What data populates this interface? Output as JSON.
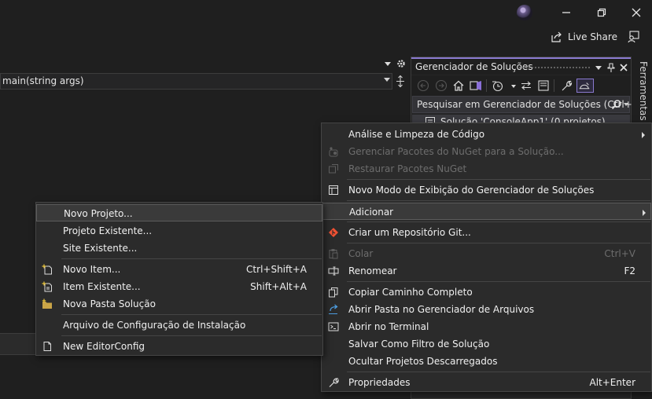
{
  "titlebar": {
    "live_share": "Live Share",
    "icons": [
      "avatar",
      "minimize-icon",
      "restore-icon",
      "close-icon",
      "live-share-icon",
      "feedback-icon"
    ]
  },
  "editor": {
    "nav_member": "main(string args)"
  },
  "solution_explorer": {
    "title": "Gerenciador de Soluções",
    "search_placeholder": "Pesquisar em Gerenciador de Soluções (Ctrl+",
    "tree_root": "Solução 'ConsoleApp1' (0 projetos)",
    "toolbar_icons": [
      "back-icon",
      "forward-icon",
      "home-icon",
      "vs-switch-icon",
      "history-icon",
      "sync-icon",
      "collapse-all-icon",
      "show-files-icon",
      "properties-icon",
      "preview-icon"
    ],
    "accent_color": "#8a7ad0"
  },
  "side_tab": {
    "label": "Ferramentas de"
  },
  "context_menu": {
    "items": [
      {
        "label": "Análise e Limpeza de Código",
        "shortcut": "",
        "submenu": true,
        "disabled": false,
        "icon": ""
      },
      {
        "label": "Gerenciar Pacotes do NuGet para a Solução...",
        "shortcut": "",
        "submenu": false,
        "disabled": true,
        "icon": "nuget-icon"
      },
      {
        "label": "Restaurar Pacotes NuGet",
        "shortcut": "",
        "submenu": false,
        "disabled": true,
        "icon": "restore-packages-icon"
      },
      {
        "label": "Novo Modo de Exibição do Gerenciador de Soluções",
        "shortcut": "",
        "submenu": false,
        "disabled": false,
        "icon": "new-view-icon"
      },
      {
        "label": "Adicionar",
        "shortcut": "",
        "submenu": true,
        "disabled": false,
        "icon": ""
      },
      {
        "label": "Criar um Repositório Git...",
        "shortcut": "",
        "submenu": false,
        "disabled": false,
        "icon": "git-icon"
      },
      {
        "label": "Colar",
        "shortcut": "Ctrl+V",
        "submenu": false,
        "disabled": true,
        "icon": "paste-icon"
      },
      {
        "label": "Renomear",
        "shortcut": "F2",
        "submenu": false,
        "disabled": false,
        "icon": "rename-icon"
      },
      {
        "label": "Copiar Caminho Completo",
        "shortcut": "",
        "submenu": false,
        "disabled": false,
        "icon": "copy-icon"
      },
      {
        "label": "Abrir Pasta no Gerenciador de Arquivos",
        "shortcut": "",
        "submenu": false,
        "disabled": false,
        "icon": "open-folder-icon"
      },
      {
        "label": "Abrir no Terminal",
        "shortcut": "",
        "submenu": false,
        "disabled": false,
        "icon": "terminal-icon"
      },
      {
        "label": "Salvar Como Filtro de Solução",
        "shortcut": "",
        "submenu": false,
        "disabled": false,
        "icon": ""
      },
      {
        "label": "Ocultar Projetos Descarregados",
        "shortcut": "",
        "submenu": false,
        "disabled": false,
        "icon": ""
      },
      {
        "label": "Propriedades",
        "shortcut": "Alt+Enter",
        "submenu": false,
        "disabled": false,
        "icon": "wrench-icon"
      }
    ],
    "highlighted": "Adicionar"
  },
  "add_submenu": {
    "items": [
      {
        "label": "Novo Projeto...",
        "shortcut": "",
        "icon": ""
      },
      {
        "label": "Projeto Existente...",
        "shortcut": "",
        "icon": ""
      },
      {
        "label": "Site Existente...",
        "shortcut": "",
        "icon": ""
      },
      {
        "label": "Novo Item...",
        "shortcut": "Ctrl+Shift+A",
        "icon": "new-item-icon"
      },
      {
        "label": "Item Existente...",
        "shortcut": "Shift+Alt+A",
        "icon": "existing-item-icon"
      },
      {
        "label": "Nova Pasta Solução",
        "shortcut": "",
        "icon": "new-folder-icon"
      },
      {
        "label": "Arquivo de Configuração de Instalação",
        "shortcut": "",
        "icon": ""
      },
      {
        "label": "New EditorConfig",
        "shortcut": "",
        "icon": "editorconfig-icon"
      }
    ],
    "highlighted": "Novo Projeto..."
  }
}
